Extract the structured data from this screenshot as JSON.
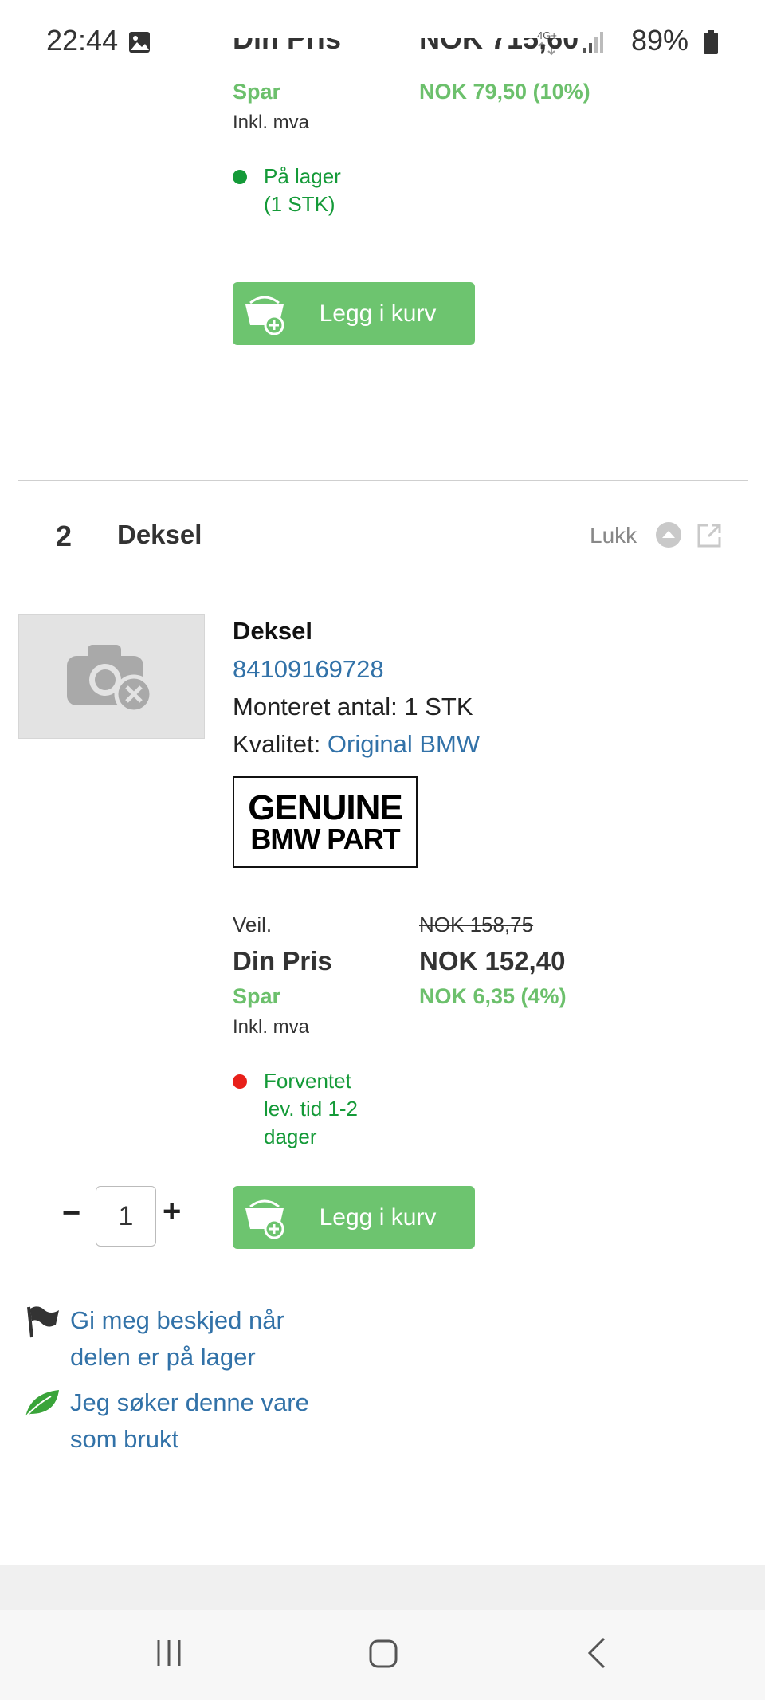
{
  "status_bar": {
    "time": "22:44",
    "network": "4G+",
    "battery": "89%"
  },
  "previous_item": {
    "price_label_cut": "Din Pris",
    "price_cut": "NOK 715,60",
    "save_label": "Spar",
    "save_value": "NOK 79,50 (10%)",
    "vat_note": "Inkl. mva",
    "stock_status": "På lager (1 STK)",
    "stock_color": "#149a38",
    "add_to_cart": "Legg i kurv"
  },
  "section": {
    "number": "2",
    "title": "Deksel",
    "close_label": "Lukk"
  },
  "product": {
    "name": "Deksel",
    "part_number": "84109169728",
    "mounted_label": "Monteret antal: 1 STK",
    "quality_label": "Kvalitet:",
    "quality_value": "Original BMW",
    "badge_line1": "GENUINE",
    "badge_line2": "BMW PART",
    "rrp_label": "Veil.",
    "rrp_value": "NOK 158,75",
    "your_price_label": "Din Pris",
    "your_price_value": "NOK 152,40",
    "save_label": "Spar",
    "save_value": "NOK 6,35 (4%)",
    "vat_note": "Inkl. mva",
    "delivery_status": "Forventet lev. tid 1-2 dager",
    "delivery_dot_color": "#e8201a",
    "quantity": "1",
    "add_to_cart": "Legg i kurv",
    "notify_link": "Gi meg beskjed når delen er på lager",
    "used_link": "Jeg søker denne vare som brukt"
  },
  "colors": {
    "accent_green": "#6dc46f",
    "link_blue": "#3272a8"
  }
}
